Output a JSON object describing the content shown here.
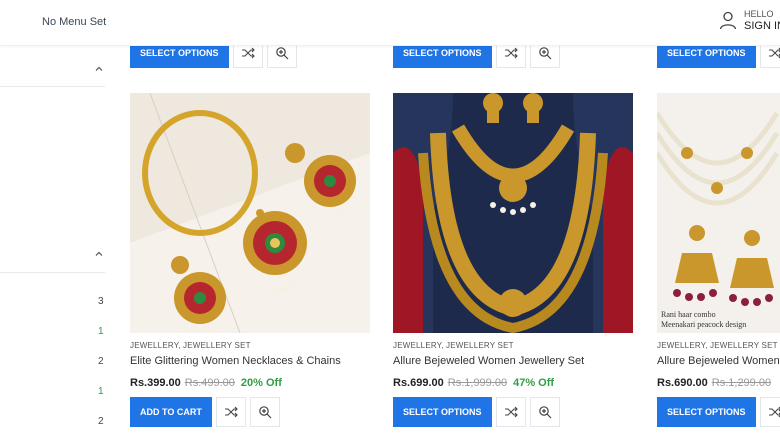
{
  "header": {
    "menu_label": "No Menu Set",
    "hello": "HELLO",
    "sign_in": "SIGN IN"
  },
  "sidebar": {
    "counts": [
      "3",
      "1",
      "2",
      "1",
      "2"
    ]
  },
  "top_row": {
    "buttons": [
      "SELECT OPTIONS",
      "SELECT OPTIONS",
      "SELECT OPTIONS"
    ]
  },
  "products": [
    {
      "category": "JEWELLERY, JEWELLERY SET",
      "title": "Elite Glittering Women Necklaces & Chains",
      "price": "Rs.399.00",
      "old_price": "Rs.499.00",
      "discount": "20% Off",
      "button": "ADD TO CART"
    },
    {
      "category": "JEWELLERY, JEWELLERY SET",
      "title": "Allure Bejeweled Women Jewellery Set",
      "price": "Rs.699.00",
      "old_price": "Rs.1,999.00",
      "discount": "47% Off",
      "button": "SELECT OPTIONS"
    },
    {
      "category": "JEWELLERY, JEWELLERY SET",
      "title": "Allure Bejeweled Women Jewellery Set",
      "price": "Rs.690.00",
      "old_price": "Rs.1,299.00",
      "discount": "",
      "button": "SELECT OPTIONS",
      "image_caption": [
        "Rani haar combo",
        "Meenakari peacock design"
      ]
    }
  ],
  "colors": {
    "primary": "#1f74e6",
    "discount": "#2f9e44"
  },
  "icons": [
    "user-icon",
    "shuffle-icon",
    "zoom-icon",
    "chevron-up-icon"
  ]
}
